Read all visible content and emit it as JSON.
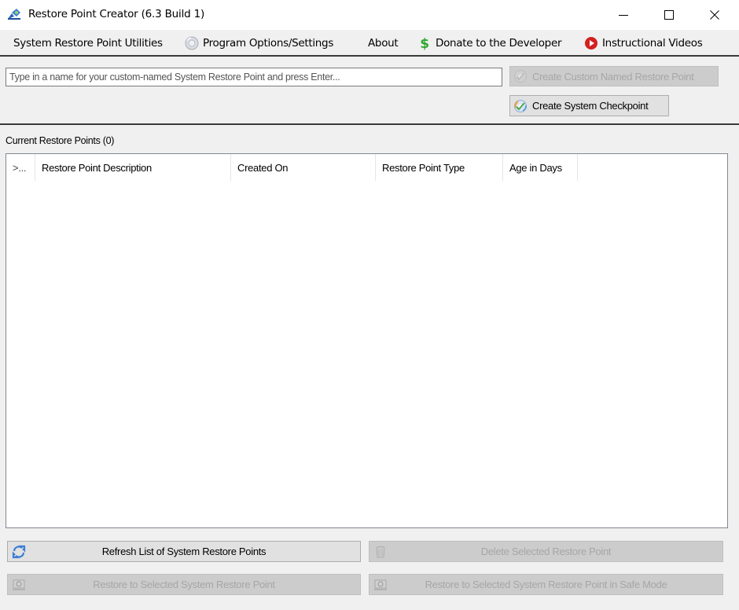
{
  "window": {
    "title": "Restore Point Creator (6.3 Build 1)",
    "app_icon": "restore-app-icon",
    "controls": {
      "minimize": "minimize-icon",
      "maximize": "maximize-icon",
      "close": "close-icon"
    }
  },
  "menubar": {
    "items": [
      {
        "label": "System Restore Point Utilities",
        "icon": null
      },
      {
        "label": "Program Options/Settings",
        "icon": "settings-disc-icon"
      },
      {
        "label": "About",
        "icon": null
      },
      {
        "label": "Donate to the Developer",
        "icon": "dollar-icon"
      },
      {
        "label": "Instructional Videos",
        "icon": "play-icon"
      }
    ]
  },
  "top_panel": {
    "name_input": {
      "value": "",
      "placeholder": "Type in a name for your custom-named System Restore Point and press Enter..."
    },
    "create_custom_button": {
      "label": "Create Custom Named Restore Point",
      "enabled": false,
      "icon": "disc-check-icon"
    },
    "create_checkpoint_button": {
      "label": "Create System Checkpoint",
      "enabled": true,
      "icon": "disc-check-icon"
    }
  },
  "restore_points": {
    "label": "Current Restore Points (0)",
    "count": 0,
    "columns": [
      ">...",
      "Restore Point Description",
      "Created On",
      "Restore Point Type",
      "Age in Days"
    ],
    "rows": []
  },
  "actions": {
    "refresh": {
      "label": "Refresh List of System Restore Points",
      "enabled": true,
      "icon": "refresh-icon"
    },
    "delete": {
      "label": "Delete Selected Restore Point",
      "enabled": false,
      "icon": "trash-icon"
    },
    "restore": {
      "label": "Restore to Selected System Restore Point",
      "enabled": false,
      "icon": "restore-monitor-icon"
    },
    "restore_safe": {
      "label": "Restore to Selected System Restore Point in Safe Mode",
      "enabled": false,
      "icon": "restore-monitor-icon"
    }
  },
  "colors": {
    "window_bg": "#f0f0f0",
    "titlebar_bg": "#ffffff",
    "disabled_text": "#a6a6a6",
    "refresh_icon": "#3b7fd6",
    "donate_icon": "#2fa62f",
    "video_icon": "#d42020"
  }
}
